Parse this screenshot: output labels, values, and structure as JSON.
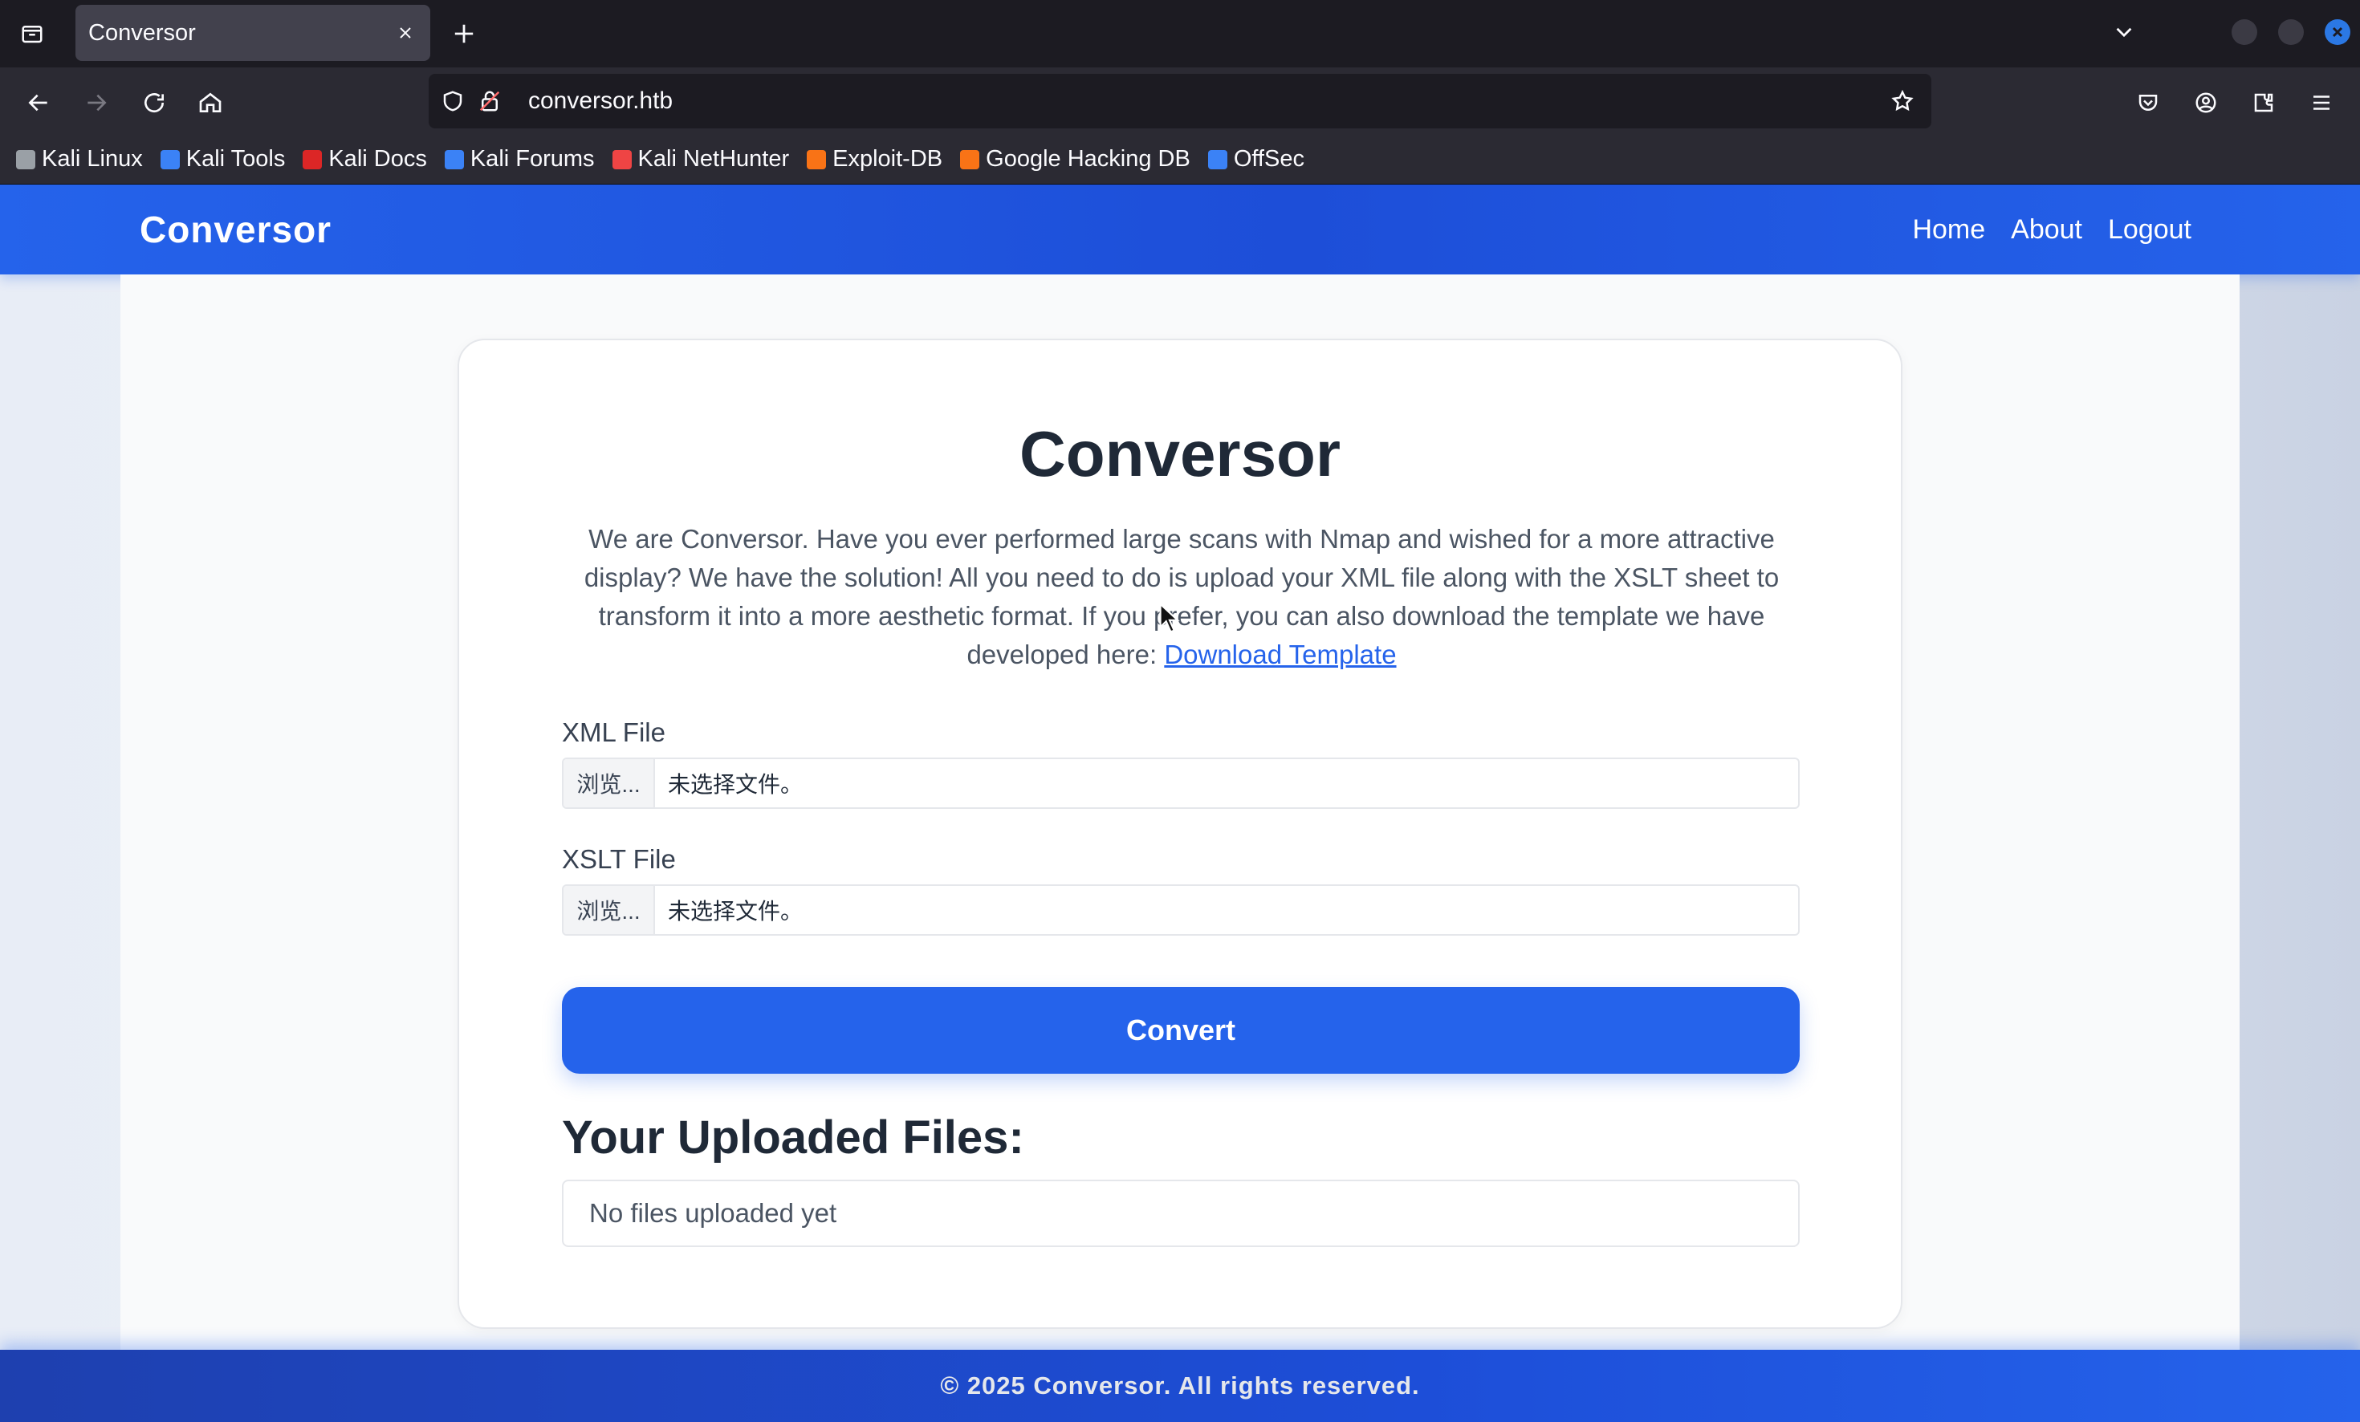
{
  "browser": {
    "tab_title": "Conversor",
    "url": "conversor.htb",
    "bookmarks": [
      {
        "label": "Kali Linux",
        "icon": "kali-dragon-icon",
        "color": "#9aa0a6"
      },
      {
        "label": "Kali Tools",
        "icon": "kali-tools-icon",
        "color": "#3b82f6"
      },
      {
        "label": "Kali Docs",
        "icon": "kali-docs-icon",
        "color": "#dc2626"
      },
      {
        "label": "Kali Forums",
        "icon": "kali-forums-icon",
        "color": "#3b82f6"
      },
      {
        "label": "Kali NetHunter",
        "icon": "kali-nethunter-icon",
        "color": "#ef4444"
      },
      {
        "label": "Exploit-DB",
        "icon": "exploit-db-icon",
        "color": "#f97316"
      },
      {
        "label": "Google Hacking DB",
        "icon": "ghdb-icon",
        "color": "#f97316"
      },
      {
        "label": "OffSec",
        "icon": "offsec-icon",
        "color": "#3b82f6"
      }
    ]
  },
  "site": {
    "brand": "Conversor",
    "nav": [
      "Home",
      "About",
      "Logout"
    ],
    "accent": "#2563eb"
  },
  "card": {
    "title": "Conversor",
    "intro_text": "We are Conversor. Have you ever performed large scans with Nmap and wished for a more attractive display? We have the solution! All you need to do is upload your XML file along with the XSLT sheet to transform it into a more aesthetic format. If you prefer, you can also download the template we have developed here: ",
    "download_link": "Download Template",
    "xml_label": "XML File",
    "xslt_label": "XSLT File",
    "browse_label": "浏览...",
    "no_file_text": "未选择文件。",
    "convert_label": "Convert",
    "uploads_title": "Your Uploaded Files:",
    "uploads_empty": "No files uploaded yet"
  },
  "footer": {
    "text": "© 2025 Conversor. All rights reserved."
  }
}
